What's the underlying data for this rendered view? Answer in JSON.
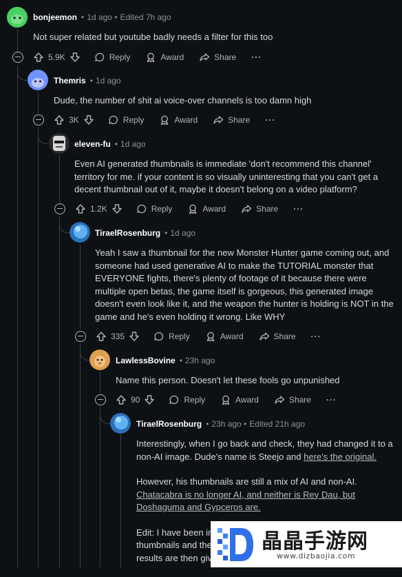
{
  "colors": {
    "background": "#0e1113",
    "text": "#d7dadc",
    "muted": "#8b9296",
    "username": "#ffffff"
  },
  "actions": {
    "reply": "Reply",
    "award": "Award",
    "share": "Share",
    "more": "···"
  },
  "comments": [
    {
      "user": "bonjeemon",
      "time": "1d ago",
      "edited": "Edited 7h ago",
      "avatar_color": "#46d160",
      "votes": "5.9K",
      "text": "Not super related but youtube badly needs a filter for this too"
    },
    {
      "user": "Themris",
      "time": "1d ago",
      "edited": "",
      "avatar_color": "#7193ff",
      "votes": "3K",
      "text": "Dude, the number of shit ai voice-over channels is too damn high"
    },
    {
      "user": "eleven-fu",
      "time": "1d ago",
      "edited": "",
      "avatar_color": "#c9c9c9",
      "votes": "1.2K",
      "text": "Even AI generated thumbnails is immediate 'don't recommend this channel' territory for me. if your content is so visually uninteresting that you can't get a decent thumbnail out of it, maybe it doesn't belong on a video platform?"
    },
    {
      "user": "TiraelRosenburg",
      "time": "1d ago",
      "edited": "",
      "avatar_color": "#4a9de0",
      "votes": "335",
      "text": "Yeah I saw a thumbnail for the new Monster Hunter game coming out, and someone had used generative AI to make the TUTORIAL monster that EVERYONE fights, there's plenty of footage of it because there were multiple open betas, the game itself is gorgeous, this generated image doesn't even look like it, and the weapon the hunter is holding is NOT in the game and he's even holding it wrong. Like WHY"
    },
    {
      "user": "LawlessBovine",
      "time": "23h ago",
      "edited": "",
      "avatar_color": "#e0a050",
      "votes": "90",
      "text": "Name this person. Doesn't let these fools go unpunished"
    },
    {
      "user": "TiraelRosenburg",
      "time": "23h ago",
      "edited": "Edited 21h ago",
      "avatar_color": "#4a9de0",
      "p1_text": "Interestingly, when I go back and check, they had changed it to a non-AI image. Dude's name is Steejo and ",
      "p1_link": "here's the original.",
      "p2_text": "However, his thumbnails are still a mix of AI and non-AI. ",
      "p2_link": "Chatacabra is no longer AI, and neither is Rey Dau, but Doshaguma and Gypceros are.",
      "p3_line1": "Edit: I have been info",
      "p3_line2": "thumbnails and these a",
      "p3_line3": "results are then given t"
    }
  ],
  "watermark": {
    "text": "晶晶手游网",
    "url": "www.dizbaojia.com"
  }
}
